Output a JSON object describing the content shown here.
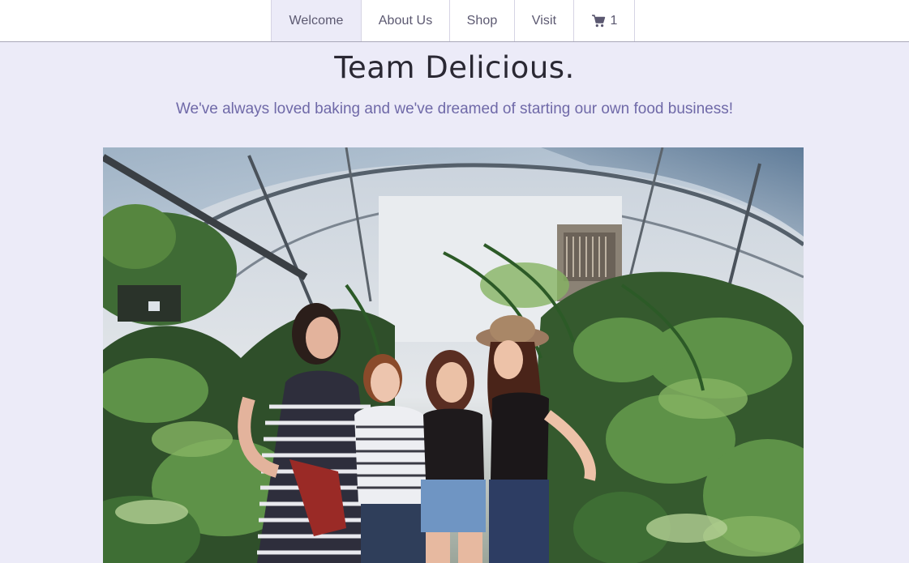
{
  "nav": {
    "items": [
      {
        "label": "Welcome",
        "active": true
      },
      {
        "label": "About Us",
        "active": false
      },
      {
        "label": "Shop",
        "active": false
      },
      {
        "label": "Visit",
        "active": false
      }
    ],
    "cart": {
      "icon": "cart-icon",
      "count": "1"
    }
  },
  "hero": {
    "title": "Team Delicious.",
    "subtitle": "We've always loved baking and we've dreamed of starting our own food business!"
  },
  "photo": {
    "subject": "group-photo-in-greenhouse"
  },
  "colors": {
    "page_bg": "#ECEBF8",
    "nav_bg": "#FFFFFF",
    "subtitle": "#6F69A8",
    "title": "#2A2833"
  }
}
